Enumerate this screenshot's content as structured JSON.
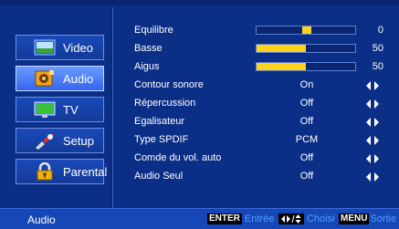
{
  "sidebar": {
    "items": [
      {
        "label": "Video",
        "icon": "video-icon",
        "active": false
      },
      {
        "label": "Audio",
        "icon": "audio-icon",
        "active": true
      },
      {
        "label": "TV",
        "icon": "tv-icon",
        "active": false
      },
      {
        "label": "Setup",
        "icon": "setup-icon",
        "active": false
      },
      {
        "label": "Parental",
        "icon": "lock-icon",
        "active": false
      }
    ]
  },
  "settings": {
    "equilibre": {
      "label": "Equilibre",
      "value": "0",
      "level": 0
    },
    "basse": {
      "label": "Basse",
      "value": "50",
      "level": 0.5
    },
    "aigus": {
      "label": "Aigus",
      "value": "50",
      "level": 0.5
    },
    "contour": {
      "label": "Contour sonore",
      "value": "On"
    },
    "repercussion": {
      "label": "Répercussion",
      "value": "Off"
    },
    "egalisateur": {
      "label": "Egalisateur",
      "value": "Off"
    },
    "spdif": {
      "label": "Type SPDIF",
      "value": "PCM"
    },
    "volauto": {
      "label": "Comde du vol. auto",
      "value": "Off"
    },
    "audioseul": {
      "label": "Audio Seul",
      "value": "Off"
    }
  },
  "footer": {
    "title": "Audio",
    "enter_key": "ENTER",
    "enter_label": "Entrée",
    "nav_label": "Choisi",
    "menu_key": "MENU",
    "menu_label": "Sortie"
  },
  "colors": {
    "background": "#0b2f86",
    "accent": "#ffd21a",
    "help_text": "#4fa0ff"
  }
}
